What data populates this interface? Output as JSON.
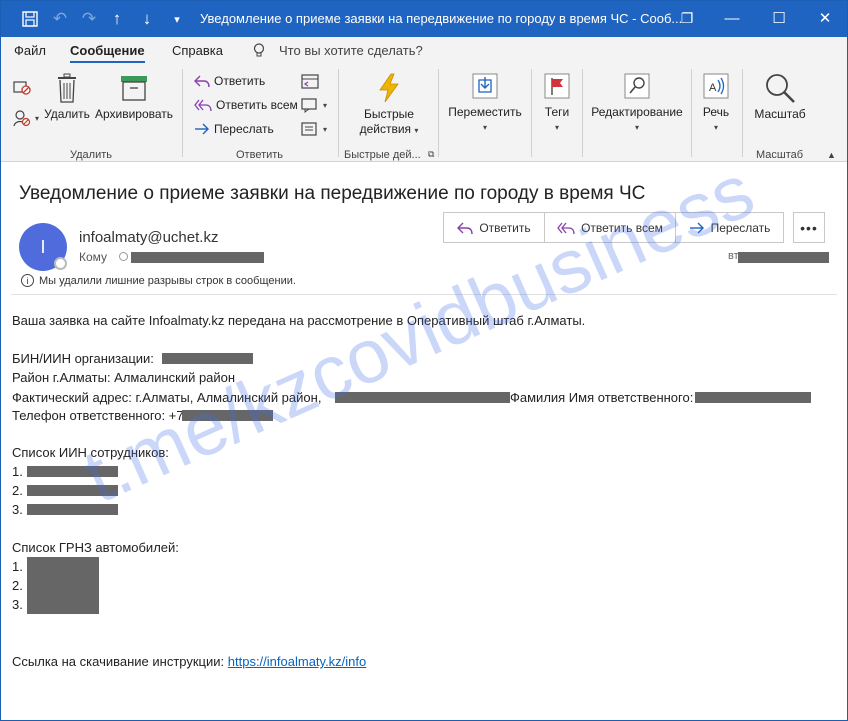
{
  "window": {
    "title": "Уведомление о приеме заявки на передвижение по городу в время ЧС  -  Сооб...",
    "restore_glyph": "❐",
    "maximize_glyph": "☐",
    "close_glyph": "✕",
    "minimize_glyph": "—"
  },
  "tabs": [
    "Файл",
    "Сообщение",
    "Справка"
  ],
  "tell_me": "Что вы хотите сделать?",
  "ribbon": {
    "delete_group": {
      "label": "Удалить",
      "delete": "Удалить",
      "archive": "Архивировать"
    },
    "respond_group": {
      "label": "Ответить",
      "reply": "Ответить",
      "reply_all": "Ответить всем",
      "forward": "Переслать"
    },
    "quick_group": {
      "label": "Быстрые дей...",
      "quick_line1": "Быстрые",
      "quick_line2": "действия"
    },
    "move": "Переместить",
    "tags": "Теги",
    "editing": "Редактирование",
    "speech": "Речь",
    "zoom": "Масштаб",
    "zoom_group": "Масштаб"
  },
  "message": {
    "subject": "Уведомление о приеме заявки на передвижение по городу в время ЧС",
    "avatar_letter": "I",
    "sender": "infoalmaty@uchet.kz",
    "to_label": "Кому",
    "date_prefix": "вт",
    "info": "Мы удалили лишние разрывы строк в сообщении.",
    "actions": {
      "reply": "Ответить",
      "reply_all": "Ответить всем",
      "forward": "Переслать",
      "more": "•••"
    }
  },
  "body": {
    "line1": "Ваша заявка на сайте Infoalmaty.kz передана на рассмотрение в Оперативный штаб г.Алматы.",
    "bin": "БИН/ИИН организации:",
    "district": "Район г.Алматы: Алмалинский район",
    "address": "Фактический адрес: г.Алматы, Алмалинский район,",
    "responsible": "Фамилия Имя ответственного:",
    "phone": "Телефон ответственного: +7",
    "iin_list_title": "Список ИИН сотрудников:",
    "iin_items": [
      "1.",
      "2.",
      "3."
    ],
    "grnz_list_title": "Список ГРНЗ автомобилей:",
    "grnz_items": [
      "1.",
      "2.",
      "3."
    ],
    "download_label": "Ссылка на скачивание инструкции:",
    "download_link": "https://infoalmaty.kz/info"
  },
  "watermark": "t.me/kzcovidbusiness"
}
